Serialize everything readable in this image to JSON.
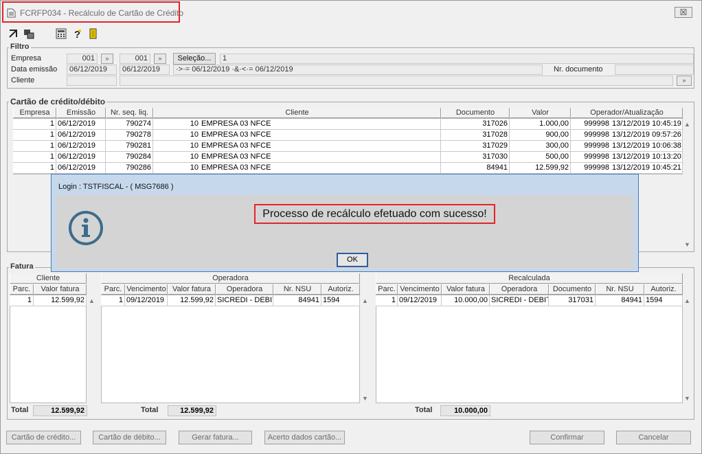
{
  "window": {
    "title": "FCRFP034 - Recálculo de Cartão de Crédito",
    "close_glyph": "☒"
  },
  "toolbar": {
    "icons": [
      "exit-arrow-icon",
      "window-switch-icon",
      "calculator-icon",
      "help-icon",
      "door-exit-icon"
    ]
  },
  "filtro": {
    "title": "Filtro",
    "empresa_label": "Empresa",
    "empresa_from": "001",
    "empresa_to": "001",
    "selecao_label": "Seleção...",
    "selecao_value": "1",
    "data_label": "Data emissão",
    "data_from": "06/12/2019",
    "data_to": "06/12/2019",
    "data_expr": "·>·= 06/12/2019 ·&·<·= 06/12/2019",
    "nr_documento_label": "Nr. documento",
    "nr_documento_value": "",
    "cliente_label": "Cliente",
    "cliente_value": "",
    "lookup_glyph": "»"
  },
  "cartao": {
    "title": "Cartão de crédito/débito",
    "headers": [
      "Empresa",
      "Emissão",
      "Nr. seq. liq.",
      "Cliente",
      "Documento",
      "Valor",
      "Operador/Atualização"
    ],
    "rows": [
      {
        "empresa": "1",
        "emissao": "06/12/2019",
        "seq": "790274",
        "cli_cod": "10",
        "cli_nome": "EMPRESA 03 NFCE",
        "documento": "317026",
        "valor": "1.000,00",
        "operador": "999998",
        "atualizacao": "13/12/2019 10:45:19"
      },
      {
        "empresa": "1",
        "emissao": "06/12/2019",
        "seq": "790278",
        "cli_cod": "10",
        "cli_nome": "EMPRESA 03 NFCE",
        "documento": "317028",
        "valor": "900,00",
        "operador": "999998",
        "atualizacao": "13/12/2019 09:57:26"
      },
      {
        "empresa": "1",
        "emissao": "06/12/2019",
        "seq": "790281",
        "cli_cod": "10",
        "cli_nome": "EMPRESA 03 NFCE",
        "documento": "317029",
        "valor": "300,00",
        "operador": "999998",
        "atualizacao": "13/12/2019 10:06:38"
      },
      {
        "empresa": "1",
        "emissao": "06/12/2019",
        "seq": "790284",
        "cli_cod": "10",
        "cli_nome": "EMPRESA 03 NFCE",
        "documento": "317030",
        "valor": "500,00",
        "operador": "999998",
        "atualizacao": "13/12/2019 10:13:20"
      },
      {
        "empresa": "1",
        "emissao": "06/12/2019",
        "seq": "790286",
        "cli_cod": "10",
        "cli_nome": "EMPRESA 03 NFCE",
        "documento": "84941",
        "valor": "12.599,92",
        "operador": "999998",
        "atualizacao": "13/12/2019 10:45:21"
      }
    ]
  },
  "fatura": {
    "title": "Fatura",
    "cliente": {
      "title": "Cliente",
      "headers": [
        "Parc.",
        "Valor fatura"
      ],
      "rows": [
        {
          "parc": "1",
          "valor": "12.599,92"
        }
      ],
      "total_label": "Total",
      "total_value": "12.599,92"
    },
    "operadora": {
      "title": "Operadora",
      "headers": [
        "Parc.",
        "Vencimento",
        "Valor fatura",
        "Operadora",
        "Nr. NSU",
        "Autoriz."
      ],
      "rows": [
        {
          "parc": "1",
          "vencimento": "09/12/2019",
          "valor": "12.599,92",
          "operadora": "SICREDI - DEBITO",
          "nsu": "84941",
          "autoriz": "1594"
        }
      ],
      "total_label": "Total",
      "total_value": "12.599,92"
    },
    "recalculada": {
      "title": "Recalculada",
      "headers": [
        "Parc.",
        "Vencimento",
        "Valor fatura",
        "Operadora",
        "Documento",
        "Nr. NSU",
        "Autoriz."
      ],
      "rows": [
        {
          "parc": "1",
          "vencimento": "09/12/2019",
          "valor": "10.000,00",
          "operadora": "SICREDI - DEBITO",
          "documento": "317031",
          "nsu": "84941",
          "autoriz": "1594"
        }
      ],
      "total_label": "Total",
      "total_value": "10.000,00"
    }
  },
  "footer": {
    "cartao_credito": "Cartão de crédito...",
    "cartao_debito": "Cartão de débito...",
    "gerar_fatura": "Gerar fatura...",
    "acerto": "Acerto dados cartão...",
    "confirmar": "Confirmar",
    "cancelar": "Cancelar"
  },
  "modal": {
    "title": "Login : TSTFISCAL - ( MSG7686 )",
    "message": "Processo de recálculo efetuado com sucesso!",
    "ok_label": "OK",
    "icon": "info-icon"
  },
  "colors": {
    "highlight": "#e0252b",
    "modal_border": "#4a78b0",
    "info_icon": "#3d6b8c"
  }
}
